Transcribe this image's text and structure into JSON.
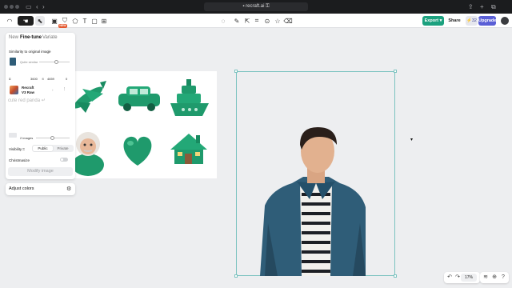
{
  "browser": {
    "url": "recraft.ai"
  },
  "toolbar": {
    "new_badge": "NEW",
    "export_label": "Export",
    "share_label": "Share",
    "credits_value": "32",
    "upgrade_label": "Upgrade"
  },
  "left_panel": {
    "tabs": [
      "New",
      "Fine-tune",
      "Variate"
    ],
    "active_tab": "Fine-tune",
    "similarity_label": "Similarity to original image",
    "similarity_value_label": "Quite similar",
    "dimensions": {
      "width": "3600",
      "height": "4659",
      "extra": "0"
    },
    "model_name": "Recraft",
    "model_version": "V3 Raw",
    "prompt_placeholder": "cute red panda",
    "images_count_label": "2 images",
    "visibility_label": "Visibility",
    "visibility_options": [
      "Public",
      "Private"
    ],
    "visibility_selected": "Public",
    "christmasize_label": "Christmasize",
    "modify_button": "Modify image"
  },
  "adjust_panel": {
    "label": "Adjust colors"
  },
  "zoom": {
    "value": "17%"
  },
  "colors": {
    "accent": "#1ca17f",
    "upgrade": "#5a5fd6",
    "object_green": "#1f9a6c",
    "selection": "#7cc3c0"
  }
}
